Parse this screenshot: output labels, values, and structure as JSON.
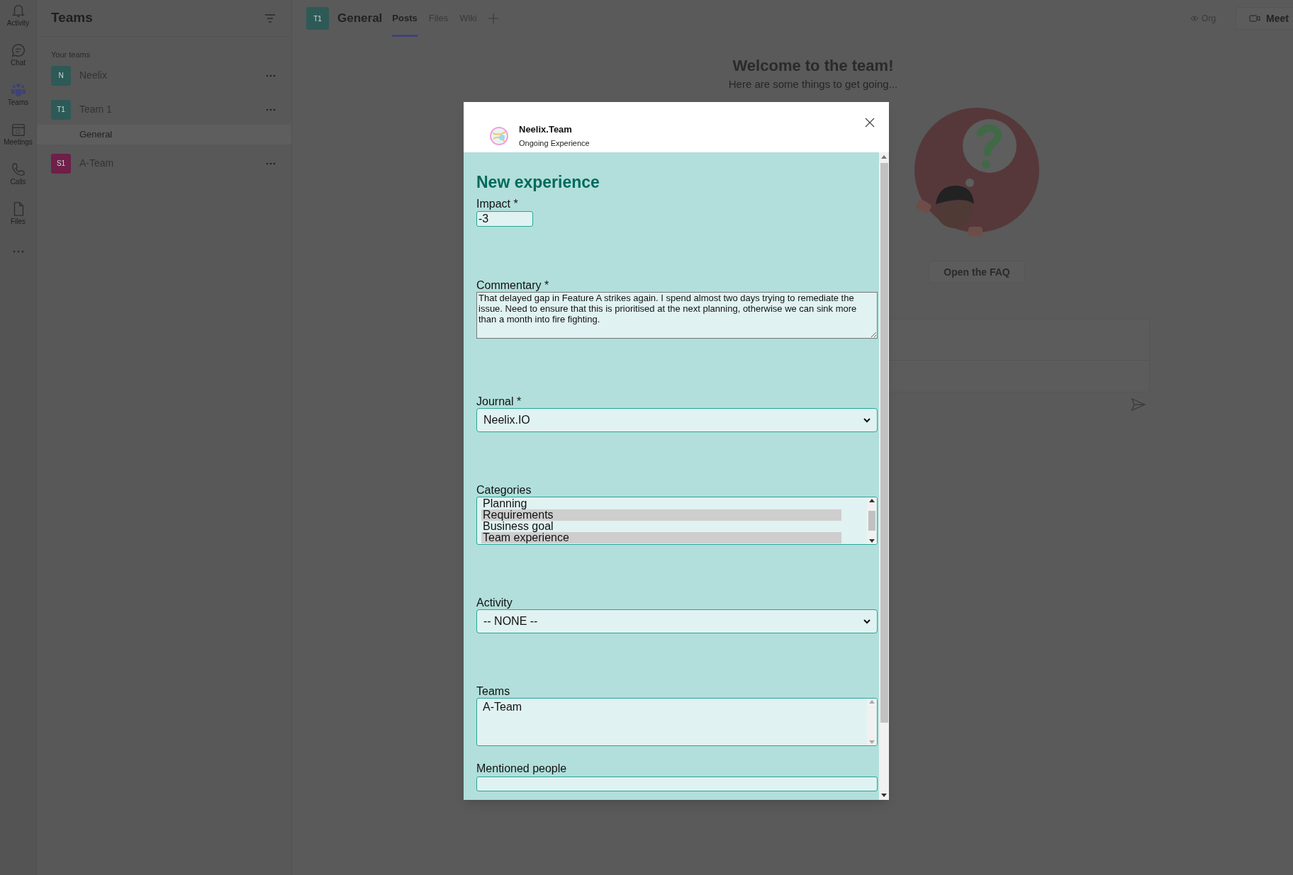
{
  "app_rail": [
    {
      "label": "Activity",
      "kind": "bell",
      "selected": false
    },
    {
      "label": "Chat",
      "kind": "chat",
      "selected": false
    },
    {
      "label": "Teams",
      "kind": "teams",
      "selected": true
    },
    {
      "label": "Meetings",
      "kind": "calendar",
      "selected": false
    },
    {
      "label": "Calls",
      "kind": "phone",
      "selected": false
    },
    {
      "label": "Files",
      "kind": "file",
      "selected": false
    }
  ],
  "sidebar": {
    "title": "Teams",
    "section": "Your teams",
    "teams": [
      {
        "initials": "N",
        "name": "Neelix",
        "color": "#2d5a57"
      },
      {
        "initials": "T1",
        "name": "Team 1",
        "color": "#2d5a57",
        "channels": [
          {
            "name": "General",
            "selected": true
          }
        ]
      },
      {
        "initials": "S1",
        "name": "A-Team",
        "color": "#6e2048"
      }
    ]
  },
  "channel_header": {
    "initials": "T1",
    "title": "General",
    "tabs": [
      {
        "label": "Posts",
        "selected": true
      },
      {
        "label": "Files",
        "selected": false
      },
      {
        "label": "Wiki",
        "selected": false
      }
    ],
    "org": "Org",
    "meet": "Meet"
  },
  "welcome": {
    "title": "Welcome to the team!",
    "subtitle": "Here are some things to get going...",
    "faq_button": "Open the FAQ"
  },
  "dialog": {
    "app_name": "Neelix.Team",
    "subtitle": "Ongoing Experience",
    "heading": "New experience",
    "fields": [
      {
        "kind": "number",
        "label": "Impact *",
        "value": "-3"
      },
      {
        "kind": "textarea",
        "label": "Commentary *",
        "value": "That delayed gap in Feature A strikes again. I spend almost two days trying to remediate the issue. Need to ensure that this is prioritised at the next planning, otherwise we can sink more than a month into fire fighting."
      },
      {
        "kind": "select",
        "label": "Journal *",
        "value": "Neelix.IO"
      },
      {
        "kind": "listbox",
        "label": "Categories",
        "options": [
          {
            "label": "Planning",
            "selected": false
          },
          {
            "label": "Requirements",
            "selected": true
          },
          {
            "label": "Business goal",
            "selected": false
          },
          {
            "label": "Team experience",
            "selected": true
          }
        ]
      },
      {
        "kind": "select",
        "label": "Activity",
        "value": "-- NONE --"
      },
      {
        "kind": "listbox",
        "label": "Teams",
        "options": [
          {
            "label": "A-Team",
            "selected": false
          }
        ]
      },
      {
        "kind": "text",
        "label": "Mentioned people"
      }
    ]
  }
}
